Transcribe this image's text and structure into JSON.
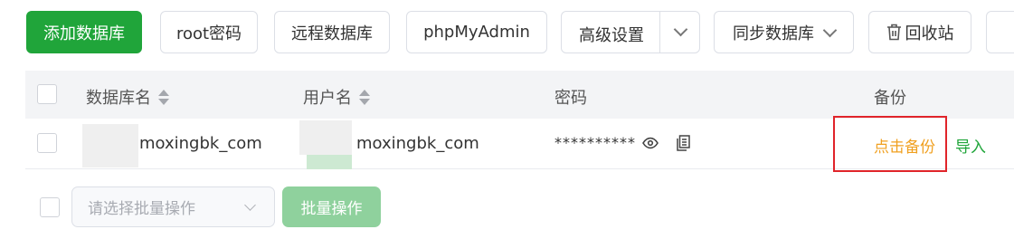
{
  "toolbar": {
    "add_db": "添加数据库",
    "root_pw": "root密码",
    "remote_db": "远程数据库",
    "phpmyadmin": "phpMyAdmin",
    "advanced": "高级设置",
    "sync_db": "同步数据库",
    "recycle": "回收站"
  },
  "table": {
    "headers": {
      "db_name": "数据库名",
      "username": "用户名",
      "password": "密码",
      "backup": "备份"
    },
    "rows": [
      {
        "db_name": "moxingbk_com",
        "username": "moxingbk_com",
        "password": "**********",
        "backup_action": "点击备份",
        "import_action": "导入"
      }
    ]
  },
  "footer": {
    "batch_placeholder": "请选择批量操作",
    "batch_button": "批量操作"
  },
  "colors": {
    "primary": "#20a53a",
    "warning": "#f0a020",
    "highlight": "#e0242a"
  }
}
